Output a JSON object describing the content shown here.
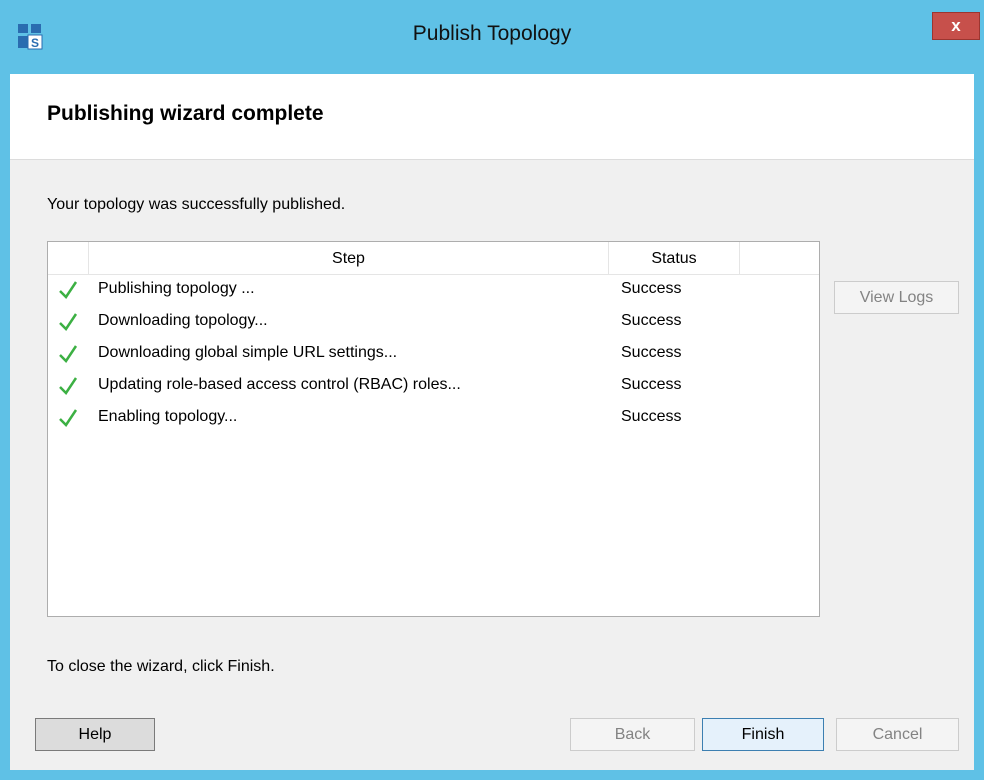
{
  "window": {
    "title": "Publish Topology",
    "close_label": "x",
    "icon": "lync-topology-icon",
    "frame_color": "#5fc1e6",
    "close_color": "#c7504b"
  },
  "header": {
    "title": "Publishing wizard complete"
  },
  "intro": "Your topology was successfully published.",
  "list": {
    "columns": [
      "Step",
      "Status"
    ],
    "rows": [
      {
        "icon": "check-icon",
        "step": "Publishing topology ...",
        "status": "Success"
      },
      {
        "icon": "check-icon",
        "step": "Downloading topology...",
        "status": "Success"
      },
      {
        "icon": "check-icon",
        "step": "Downloading global simple URL settings...",
        "status": "Success"
      },
      {
        "icon": "check-icon",
        "step": "Updating role-based access control (RBAC) roles...",
        "status": "Success"
      },
      {
        "icon": "check-icon",
        "step": "Enabling topology...",
        "status": "Success"
      }
    ],
    "success_color": "#3cb043"
  },
  "view_logs_label": "View Logs",
  "footer_text": "To close the wizard, click Finish.",
  "buttons": {
    "help": "Help",
    "back": "Back",
    "finish": "Finish",
    "cancel": "Cancel"
  }
}
